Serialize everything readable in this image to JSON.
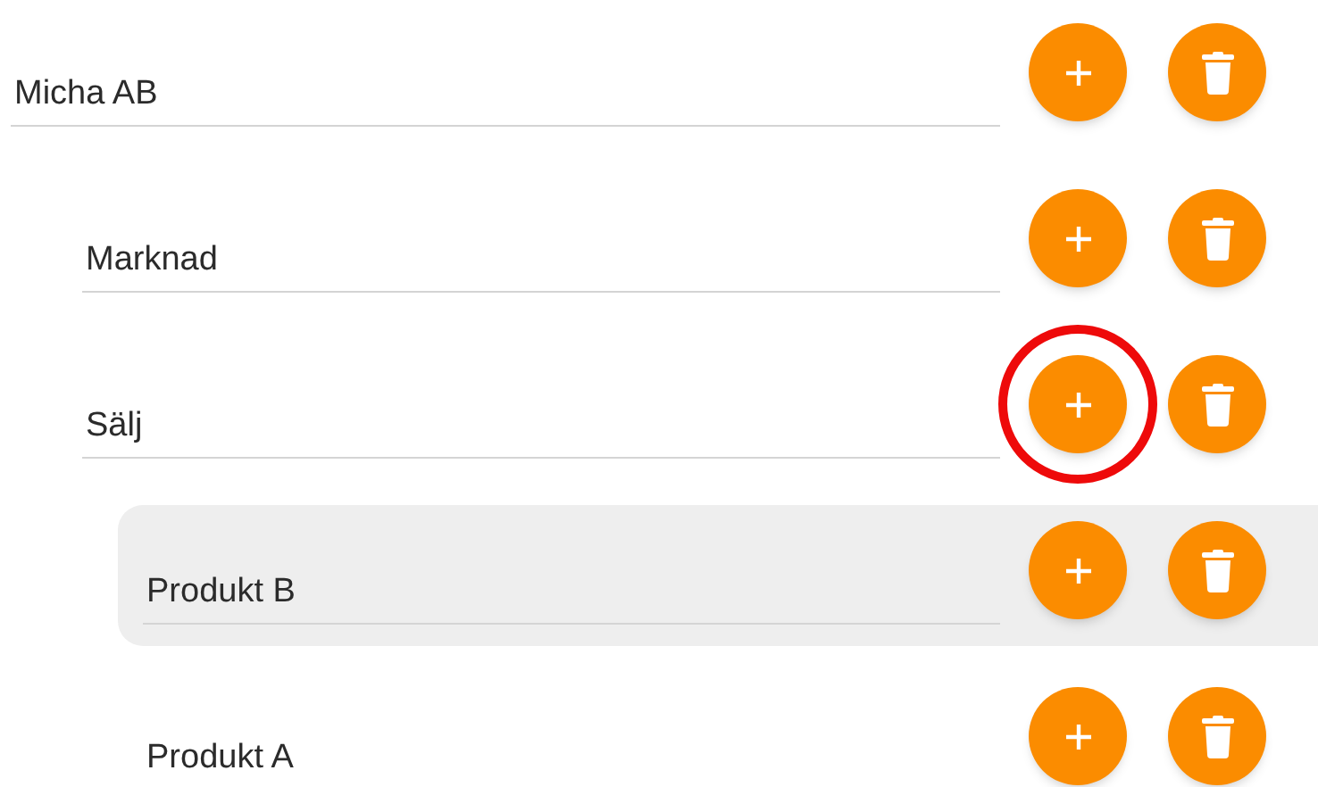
{
  "units": [
    {
      "name": "Micha AB",
      "selected": false,
      "add_highlighted": false,
      "children": [
        {
          "name": "Marknad",
          "selected": false,
          "add_highlighted": false
        },
        {
          "name": "Sälj",
          "selected": false,
          "add_highlighted": true,
          "children": [
            {
              "name": "Produkt B",
              "selected": true,
              "add_highlighted": false
            },
            {
              "name": "Produkt A",
              "selected": false,
              "add_highlighted": false
            }
          ]
        }
      ]
    }
  ]
}
